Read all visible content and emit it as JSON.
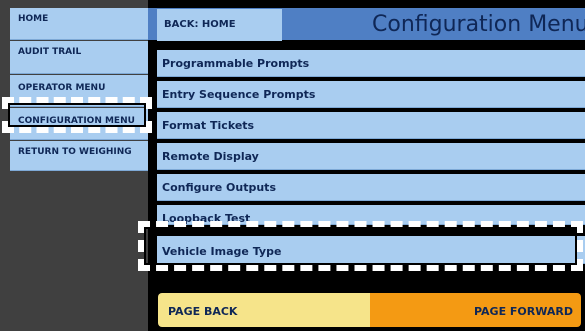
{
  "sidebar": {
    "items": [
      {
        "label": "HOME"
      },
      {
        "label": "AUDIT TRAIL"
      },
      {
        "label": "OPERATOR MENU"
      },
      {
        "label": "CONFIGURATION MENU"
      },
      {
        "label": "RETURN TO WEIGHING"
      }
    ]
  },
  "header": {
    "back_label": "BACK: HOME",
    "title": "Configuration Menu"
  },
  "menu": {
    "items": [
      {
        "label": "Programmable Prompts"
      },
      {
        "label": "Entry Sequence Prompts"
      },
      {
        "label": "Format Tickets"
      },
      {
        "label": "Remote Display"
      },
      {
        "label": "Configure Outputs"
      },
      {
        "label": "Loopback Test"
      },
      {
        "label": "Vehicle Image Type"
      }
    ]
  },
  "footer": {
    "page_back": "PAGE BACK",
    "page_forward": "PAGE FORWARD"
  },
  "colors": {
    "button_bg": "#a9cdf0",
    "header_bg": "#4f7fc4",
    "page_back_bg": "#f6e48a",
    "page_forward_bg": "#f49a13",
    "text": "#0f2756"
  }
}
